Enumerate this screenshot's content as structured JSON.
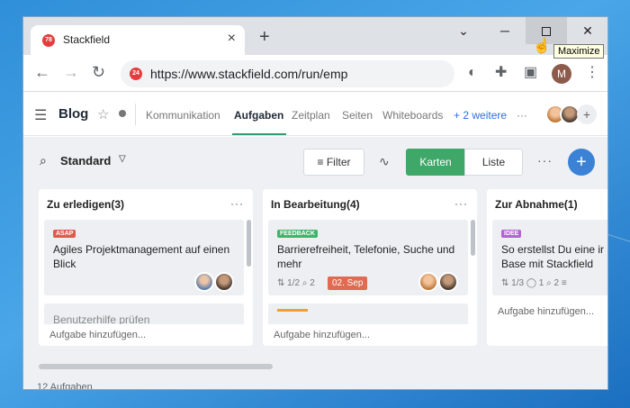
{
  "browser": {
    "tab": {
      "favicon_badge": "78",
      "title": "Stackfield",
      "close": "×"
    },
    "new_tab": "+",
    "window_controls": {
      "dropdown": "⌄",
      "minimize": "─",
      "close": "✕"
    },
    "tooltip": "Maximize",
    "url": "https://www.stackfield.com/run/emp",
    "omnibox_badge": "24",
    "profile_initial": "M"
  },
  "app": {
    "title": "Blog",
    "nav": {
      "tabs": [
        "Kommunikation",
        "Aufgaben",
        "Zeitplan",
        "Seiten",
        "Whiteboards"
      ],
      "more": "+ 2 weitere",
      "overflow": "···"
    }
  },
  "board": {
    "view_name": "Standard",
    "filter_label": "Filter",
    "view_toggle": [
      "Karten",
      "Liste"
    ],
    "more": "···",
    "add": "+",
    "columns": [
      {
        "title": "Zu erledigen(3)",
        "cards": [
          {
            "tag": "ASAP",
            "tag_color": "#e05a4e",
            "title": "Agiles Projektmanagement auf einen Blick"
          },
          {
            "title": "Benutzerhilfe prüfen"
          }
        ],
        "footer": "Aufgabe hinzufügen..."
      },
      {
        "title": "In Bearbeitung(4)",
        "cards": [
          {
            "tag": "FEEDBACK",
            "tag_color": "#3fb56a",
            "title": "Barrierefreiheit, Telefonie, Suche und mehr",
            "meta": "⇅ 1/2   ⌕ 2",
            "date": "02. Sep"
          }
        ],
        "footer": "Aufgabe hinzufügen..."
      },
      {
        "title": "Zur Abnahme(1)",
        "cards": [
          {
            "tag": "IDEE",
            "tag_color": "#b562d6",
            "title": "So erstellst Du eine ir Base mit Stackfield",
            "meta": "⇅ 1/3  ◯ 1  ⌕ 2  ≡"
          }
        ],
        "footer": "Aufgabe hinzufügen..."
      }
    ],
    "task_count": "12 Aufgaben"
  }
}
